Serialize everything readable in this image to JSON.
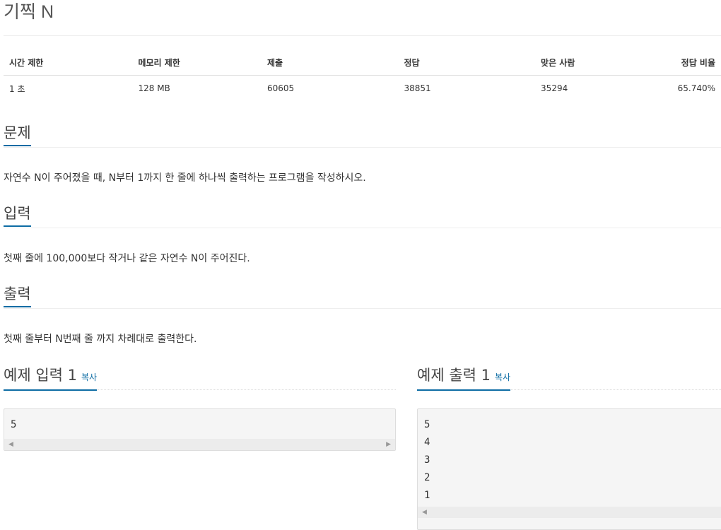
{
  "problem": {
    "title": "기찍 N"
  },
  "stats": {
    "headers": [
      "시간 제한",
      "메모리 제한",
      "제출",
      "정답",
      "맞은 사람",
      "정답 비율"
    ],
    "values": [
      "1 초",
      "128 MB",
      "60605",
      "38851",
      "35294",
      "65.740%"
    ]
  },
  "sections": {
    "description": {
      "heading": "문제",
      "text": "자연수 N이 주어졌을 때, N부터 1까지 한 줄에 하나씩 출력하는 프로그램을 작성하시오."
    },
    "input": {
      "heading": "입력",
      "text": "첫째 줄에 100,000보다 작거나 같은 자연수 N이 주어진다."
    },
    "output": {
      "heading": "출력",
      "text": "첫째 줄부터 N번째 줄 까지 차례대로 출력한다."
    }
  },
  "samples": {
    "input": {
      "heading": "예제 입력 1",
      "copy_label": "복사",
      "lines": [
        "5"
      ]
    },
    "output": {
      "heading": "예제 출력 1",
      "copy_label": "복사",
      "lines": [
        "5",
        "4",
        "3",
        "2",
        "1"
      ]
    }
  },
  "icons": {
    "scroll_left": "left-arrow-icon",
    "scroll_right": "right-arrow-icon"
  },
  "colors": {
    "accent": "#0d6ca4",
    "pre_background": "#f5f5f5"
  }
}
